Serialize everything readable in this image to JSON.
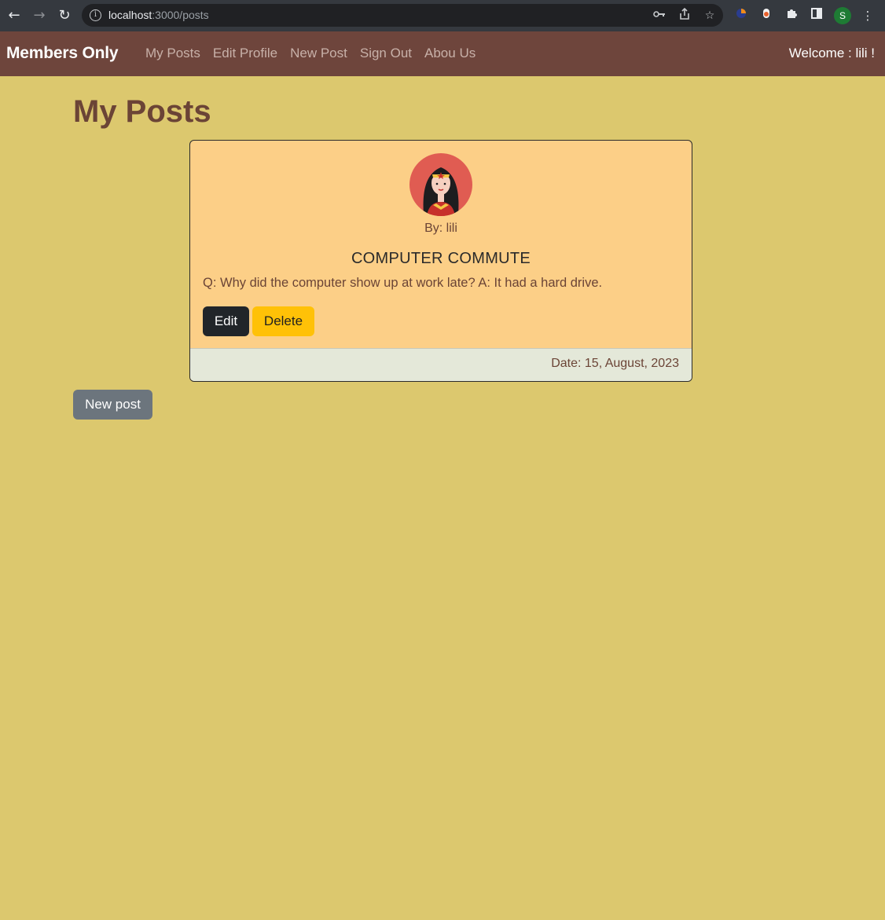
{
  "browser": {
    "url_host": "localhost",
    "url_path": ":3000/posts",
    "profile_initial": "S",
    "icons": [
      "back-icon",
      "forward-icon",
      "reload-icon",
      "info-icon",
      "key-icon",
      "share-icon",
      "star-icon",
      "extension-icon",
      "puzzle-icon",
      "sidebar-icon",
      "menu-icon"
    ]
  },
  "navbar": {
    "brand": "Members Only",
    "links": [
      "My Posts",
      "Edit Profile",
      "New Post",
      "Sign Out",
      "Abou Us"
    ],
    "welcome": "Welcome : lili !",
    "bg_color": "#6e453c"
  },
  "main": {
    "title": "My Posts",
    "bg_color": "#dcc86e",
    "new_post_label": "New post"
  },
  "post": {
    "author": "By: lili",
    "title": "COMPUTER COMMUTE",
    "body": "Q: Why did the computer show up at work late? A: It had a hard drive.",
    "edit_label": "Edit",
    "delete_label": "Delete",
    "date": "Date: 15, August, 2023",
    "card_color": "#fccf87"
  }
}
